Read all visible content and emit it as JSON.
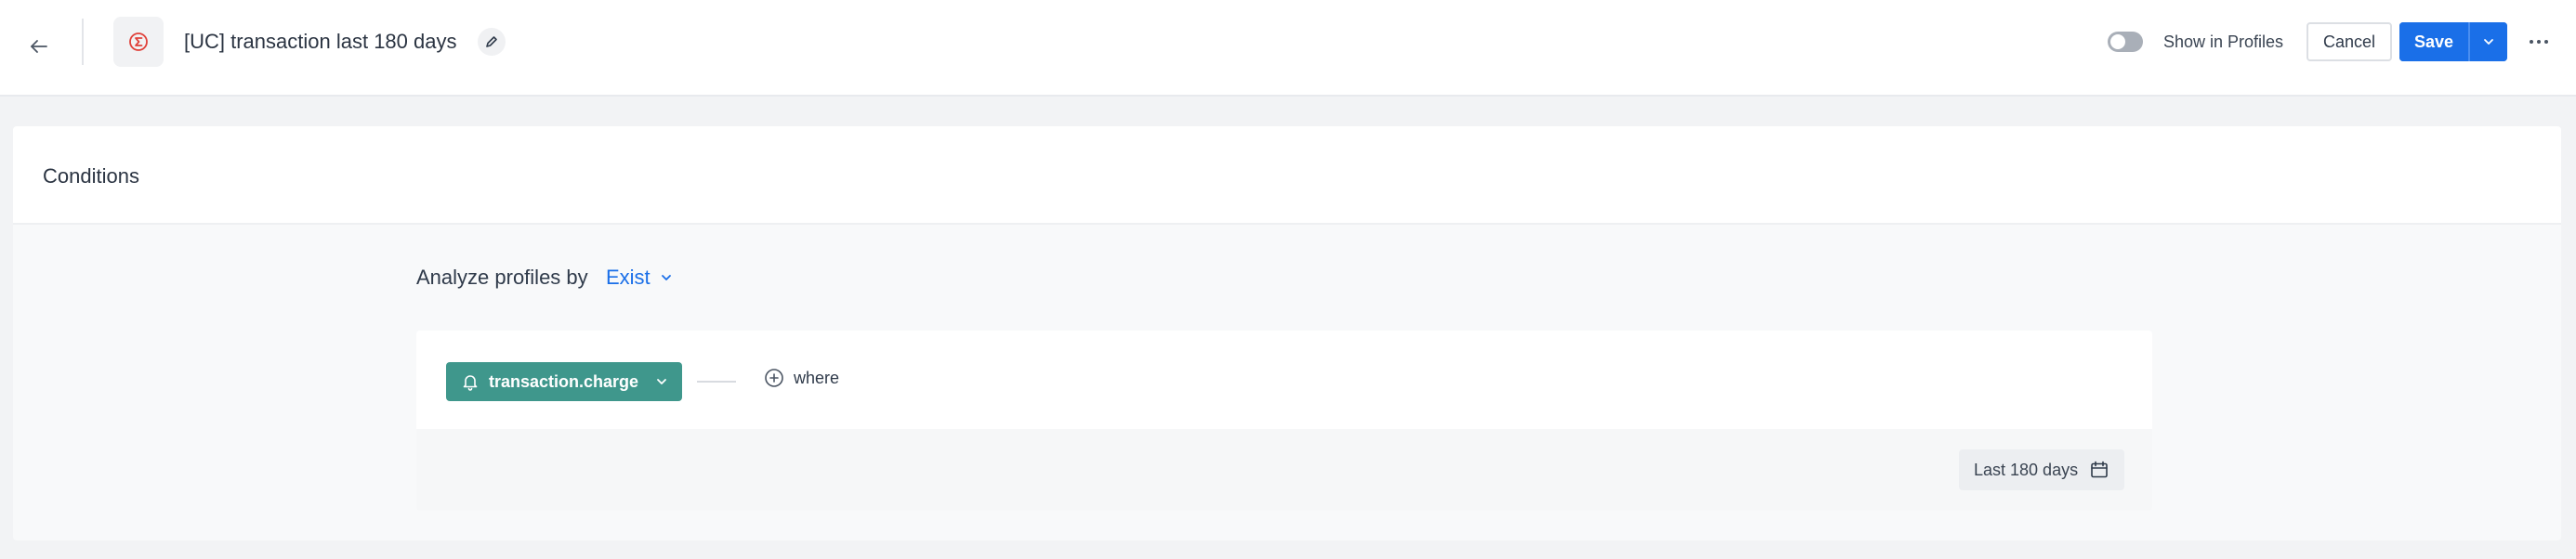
{
  "header": {
    "title": "[UC] transaction last 180 days",
    "segment_icon": "sigma-icon",
    "back_icon": "arrow-left-icon",
    "edit_icon": "pencil-icon",
    "show_in_profiles": {
      "label": "Show in Profiles",
      "enabled": false
    },
    "cancel_label": "Cancel",
    "save_label": "Save",
    "save_menu_icon": "chevron-down-icon",
    "more_icon": "more-horizontal-icon"
  },
  "conditions": {
    "title": "Conditions",
    "analyze_label": "Analyze profiles by",
    "analyze_value": "Exist",
    "event": {
      "label": "transaction.charge",
      "icon": "bell-icon",
      "color": "#3f978c"
    },
    "where_label": "where",
    "where_icon": "plus-circle-icon",
    "date_range": {
      "label": "Last 180 days",
      "icon": "calendar-icon"
    }
  },
  "colors": {
    "accent": "#1a6fe8",
    "danger": "#e0413a",
    "event_pill": "#3f978c"
  }
}
